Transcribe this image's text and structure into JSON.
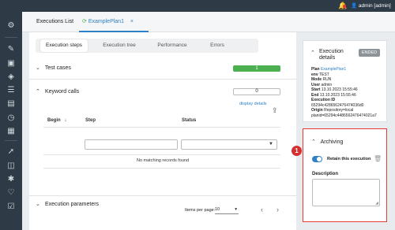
{
  "topbar": {
    "user_label": "admin [admin]"
  },
  "sidebar": {
    "icons": [
      "settings-icon",
      "edit-icon",
      "box-icon",
      "cube-icon",
      "list-icon",
      "document-icon",
      "history-icon",
      "calendar-icon",
      "rocket-icon",
      "layers-icon",
      "bug-icon",
      "heart-icon",
      "checklist-icon"
    ]
  },
  "tabs": {
    "executions_list": "Executions List",
    "plan": "ExamplePlan1",
    "close": "×"
  },
  "subtabs": [
    "Execution steps",
    "Execution tree",
    "Performance",
    "Errors"
  ],
  "test_cases": {
    "label": "Test cases",
    "count": "1"
  },
  "keyword_calls": {
    "label": "Keyword calls",
    "count": "0",
    "display_details": "display details",
    "columns": {
      "begin": "Begin",
      "step": "Step",
      "status": "Status"
    },
    "empty_message": "No matching records found",
    "items_per_page_label": "Items per page:",
    "items_per_page_value": "10"
  },
  "execution_parameters": {
    "label": "Execution parameters"
  },
  "execution_details": {
    "title": "Execution details",
    "status": "ENDED",
    "rows": [
      {
        "label": "Plan",
        "value": "ExamplePlan1"
      },
      {
        "label": "env",
        "value": "TEST"
      },
      {
        "label": "Mode",
        "value": "RUN"
      },
      {
        "label": "User",
        "value": "admin"
      },
      {
        "label": "Start",
        "value": "13.10.2023 15:55:46"
      },
      {
        "label": "End",
        "value": "13.10.2023 15:55:46"
      },
      {
        "label": "Execution ID",
        "value": "65294c4286562476474036d0"
      },
      {
        "label": "Origin",
        "value": "Repository=local"
      },
      {
        "label": "",
        "value": "planid=65294c4486562476474021a7"
      }
    ]
  },
  "archiving": {
    "title": "Archiving",
    "retain_label": "Retain this execution",
    "retain_on": true,
    "description_label": "Description",
    "description_value": ""
  },
  "callout": {
    "number": "1"
  },
  "colors": {
    "accent": "#2f80c4",
    "success": "#4caf50",
    "danger": "#d32f2f",
    "sidebar": "#2e3a46"
  }
}
